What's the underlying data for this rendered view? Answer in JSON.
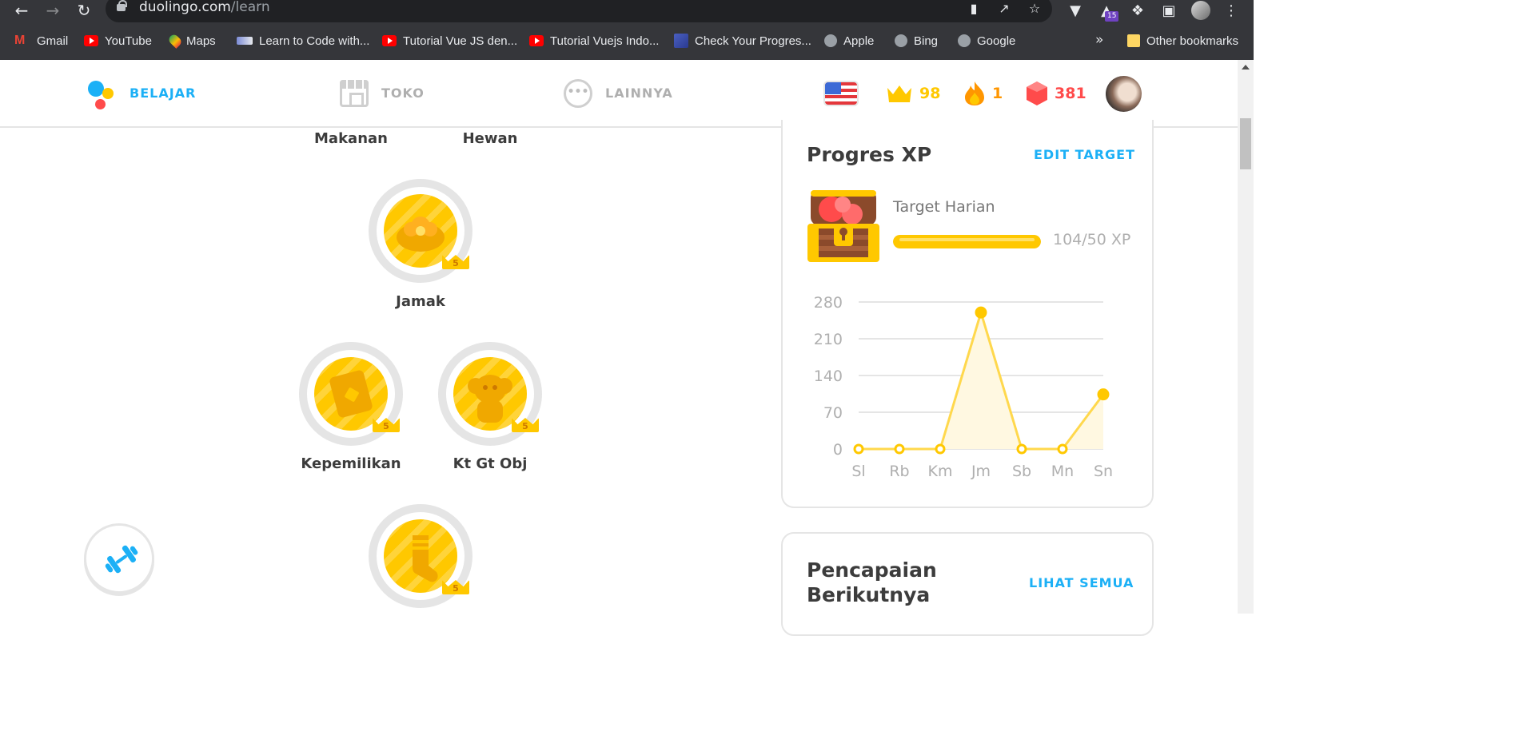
{
  "browser": {
    "url_host": "duolingo.com",
    "url_path": "/learn",
    "extension_badge": "15",
    "bookmarks": [
      {
        "label": "Gmail",
        "icon": "gmail-icon"
      },
      {
        "label": "YouTube",
        "icon": "youtube-icon"
      },
      {
        "label": "Maps",
        "icon": "maps-icon"
      },
      {
        "label": "Learn to Code with...",
        "icon": "code-icon"
      },
      {
        "label": "Tutorial Vue JS den...",
        "icon": "youtube-icon"
      },
      {
        "label": "Tutorial Vuejs Indo...",
        "icon": "youtube-icon"
      },
      {
        "label": "Check Your Progres...",
        "icon": "cypress-icon"
      },
      {
        "label": "Apple",
        "icon": "globe-icon"
      },
      {
        "label": "Bing",
        "icon": "globe-icon"
      },
      {
        "label": "Google",
        "icon": "globe-icon"
      }
    ],
    "more_bookmarks": "»",
    "other_bookmarks": "Other bookmarks"
  },
  "header": {
    "nav": {
      "learn": "BELAJAR",
      "shop": "TOKO",
      "more": "LAINNYA"
    },
    "crowns": "98",
    "streak": "1",
    "gems": "381",
    "colors": {
      "active": "#1cb0f6",
      "crown": "#ffc800",
      "streak": "#ff9600",
      "gems": "#ff4b4b"
    }
  },
  "skills": {
    "top_labels": [
      "Makanan",
      "Hewan"
    ],
    "items": [
      {
        "name": "Jamak",
        "level": "5"
      },
      {
        "name": "Kepemilikan",
        "level": "5"
      },
      {
        "name": "Kt Gt Obj",
        "level": "5"
      },
      {
        "name": "",
        "level": "5"
      }
    ]
  },
  "xp_card": {
    "title": "Progres XP",
    "edit_link": "EDIT TARGET",
    "goal_label": "Target Harian",
    "goal_progress": 1.0,
    "goal_text": "104/50 XP"
  },
  "chart_data": {
    "type": "area",
    "categories": [
      "Sl",
      "Rb",
      "Km",
      "Jm",
      "Sb",
      "Mn",
      "Sn"
    ],
    "values": [
      0,
      0,
      0,
      260,
      0,
      0,
      104
    ],
    "yticks": [
      280,
      210,
      140,
      70,
      0
    ],
    "ylim": [
      0,
      280
    ],
    "grid": true,
    "color": "#ffc800"
  },
  "achievements_card": {
    "title_line1": "Pencapaian",
    "title_line2": "Berikutnya",
    "link": "LIHAT SEMUA"
  }
}
